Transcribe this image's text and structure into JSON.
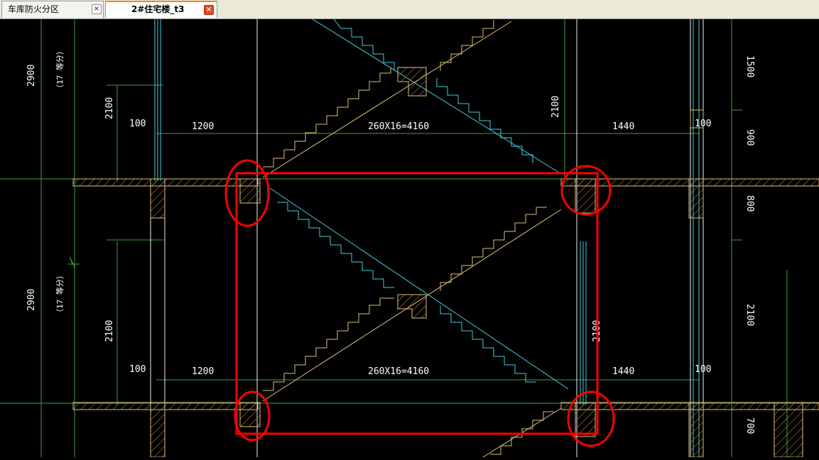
{
  "tabs": [
    {
      "label": "车库防火分区",
      "close": "×"
    },
    {
      "label": "2#住宅楼_t3",
      "close": "×"
    }
  ],
  "drawing": {
    "upper_left_dim": "2900",
    "upper_left_sub": "（17 等分）",
    "lower_left_dim": "2900",
    "lower_left_sub": "（17 等分）",
    "dim_2100_a": "2100",
    "dim_2100_b": "2100",
    "dim_2100_c": "2100",
    "dim_2100_d": "2100",
    "dim_100_a": "100",
    "dim_100_b": "100",
    "dim_100_c": "100",
    "dim_100_d": "100",
    "dim_1200_a": "1200",
    "dim_1200_b": "1200",
    "dim_stair_a": "260X16=4160",
    "dim_stair_b": "260X16=4160",
    "dim_1440_a": "1440",
    "dim_1440_b": "1440",
    "right_1500": "1500",
    "right_900": "900",
    "right_800": "800",
    "right_2100": "2100",
    "right_700": "700"
  },
  "colors": {
    "background": "#000000",
    "wall": "#e0c07a",
    "hatch": "#b08040",
    "cyan": "#40d0e0",
    "green": "#40a040",
    "dim_text": "#ffffff",
    "highlight": "#ff0000"
  }
}
